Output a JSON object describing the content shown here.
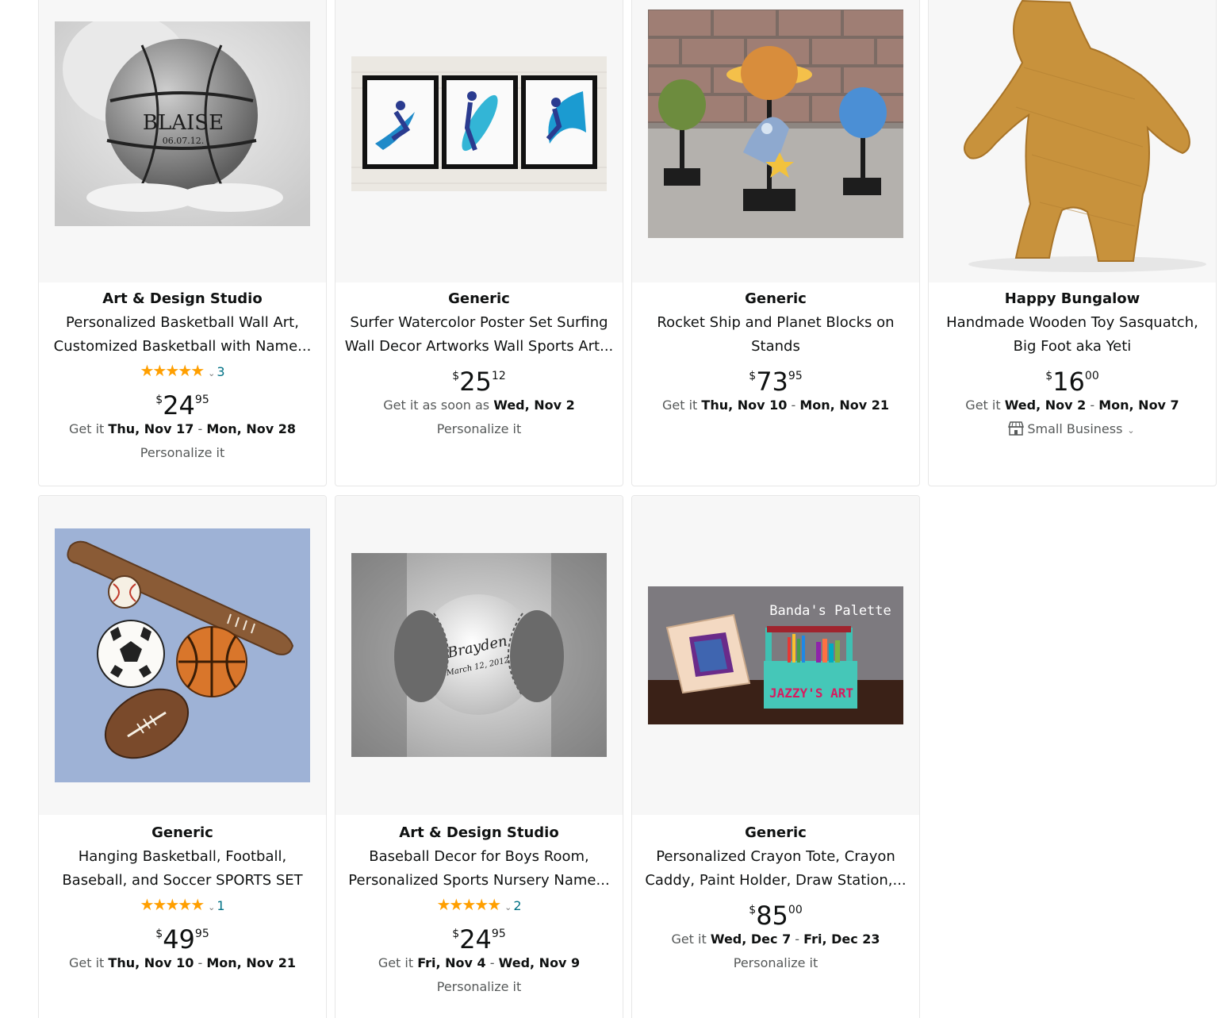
{
  "products": [
    {
      "brand": "Art & Design Studio",
      "title": "Personalized Basketball Wall Art, Customized Basketball with Name...",
      "stars": "★★★★★",
      "rating_count": "3",
      "price_symbol": "$",
      "price_whole": "24",
      "price_fraction": "95",
      "delivery_prefix": "Get it",
      "delivery_start": "Thu, Nov 17",
      "delivery_sep": " - ",
      "delivery_end": "Mon, Nov 28",
      "extra": "Personalize it",
      "image_text_1": "BLAISE",
      "image_text_2": "06.07.12."
    },
    {
      "brand": "Generic",
      "title": "Surfer Watercolor Poster Set Surfing Wall Decor Artworks Wall Sports Art...",
      "price_symbol": "$",
      "price_whole": "25",
      "price_fraction": "12",
      "delivery_prefix": "Get it as soon as",
      "delivery_start": "Wed, Nov 2",
      "extra": "Personalize it"
    },
    {
      "brand": "Generic",
      "title": "Rocket Ship and Planet Blocks on Stands",
      "price_symbol": "$",
      "price_whole": "73",
      "price_fraction": "95",
      "delivery_prefix": "Get it",
      "delivery_start": "Thu, Nov 10",
      "delivery_sep": " - ",
      "delivery_end": "Mon, Nov 21"
    },
    {
      "brand": "Happy Bungalow",
      "title": "Handmade Wooden Toy Sasquatch, Big Foot aka Yeti",
      "price_symbol": "$",
      "price_whole": "16",
      "price_fraction": "00",
      "delivery_prefix": "Get it",
      "delivery_start": "Wed, Nov 2",
      "delivery_sep": " - ",
      "delivery_end": "Mon, Nov 7",
      "badge": "Small Business",
      "badge_icon": "store-icon"
    },
    {
      "brand": "Generic",
      "title": "Hanging Basketball, Football, Baseball, and Soccer SPORTS SET",
      "stars": "★★★★★",
      "rating_count": "1",
      "price_symbol": "$",
      "price_whole": "49",
      "price_fraction": "95",
      "delivery_prefix": "Get it",
      "delivery_start": "Thu, Nov 10",
      "delivery_sep": " - ",
      "delivery_end": "Mon, Nov 21"
    },
    {
      "brand": "Art & Design Studio",
      "title": "Baseball Decor for Boys Room, Personalized Sports Nursery Name...",
      "stars": "★★★★★",
      "rating_count": "2",
      "price_symbol": "$",
      "price_whole": "24",
      "price_fraction": "95",
      "delivery_prefix": "Get it",
      "delivery_start": "Fri, Nov 4",
      "delivery_sep": " - ",
      "delivery_end": "Wed, Nov 9",
      "extra": "Personalize it",
      "image_text_1": "Brayden",
      "image_text_2": "March 12, 2012"
    },
    {
      "brand": "Generic",
      "title": "Personalized Crayon Tote, Crayon Caddy, Paint Holder, Draw Station,...",
      "price_symbol": "$",
      "price_whole": "85",
      "price_fraction": "00",
      "delivery_prefix": "Get it",
      "delivery_start": "Wed, Dec 7",
      "delivery_sep": " - ",
      "delivery_end": "Fri, Dec 23",
      "extra": "Personalize it",
      "image_text_1": "Banda's Palette",
      "image_text_2": "JAZZY'S ART"
    }
  ],
  "colors": {
    "star": "#ff9f00",
    "link": "#007185",
    "muted": "#565959",
    "text": "#0f1111",
    "image_bg": "#f7f7f7"
  }
}
